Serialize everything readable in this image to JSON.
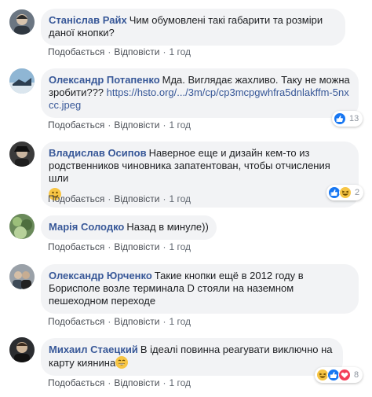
{
  "actions": {
    "like": "Подобається",
    "reply": "Відповісти",
    "sep": "·"
  },
  "comments": [
    {
      "author": "Станіслав Райх",
      "text": "Чим обумовлені такі габарити та розміри даної кнопки?",
      "time": "1 год"
    },
    {
      "author": "Олександр Потапенко",
      "text": "Мда. Виглядає жахливо. Таку не можна зробити???",
      "link": "https://hsto.org/.../3m/cp/cp3mcpgwhfra5dnlakffm-5nxcc.jpeg",
      "time": "1 год",
      "reactions": {
        "icons": [
          "like-icon"
        ],
        "count": "13"
      }
    },
    {
      "author": "Владислав Осипов",
      "text": "Наверное еще и дизайн кем-то из родственников чиновника запатентован, чтобы отчисления шли",
      "emoji": "smile-emoji-icon",
      "time": "1 год",
      "reactions": {
        "icons": [
          "like-icon",
          "haha-icon"
        ],
        "count": "2"
      }
    },
    {
      "author": "Марія Солодко",
      "text": "Назад в минуле))",
      "time": "1 год"
    },
    {
      "author": "Олександр Юрченко",
      "text": "Такие кнопки ещё в 2012 году в Борисполе возле терминала D стояли на наземном пешеходном переходе",
      "time": "1 год"
    },
    {
      "author": "Михаил Стаецкий",
      "text": "В ідеалі повинна реагувати виключно на карту киянина",
      "emoji": "grin-emoji-icon",
      "time": "1 год",
      "reactions": {
        "icons": [
          "haha-icon",
          "like-icon",
          "love-icon"
        ],
        "count": "8"
      }
    }
  ],
  "colors": {
    "author": "#385898",
    "bubble": "#f2f3f5",
    "meta": "#606770",
    "like": "#1877f2",
    "haha": "#f7c544",
    "love": "#f33e58"
  }
}
